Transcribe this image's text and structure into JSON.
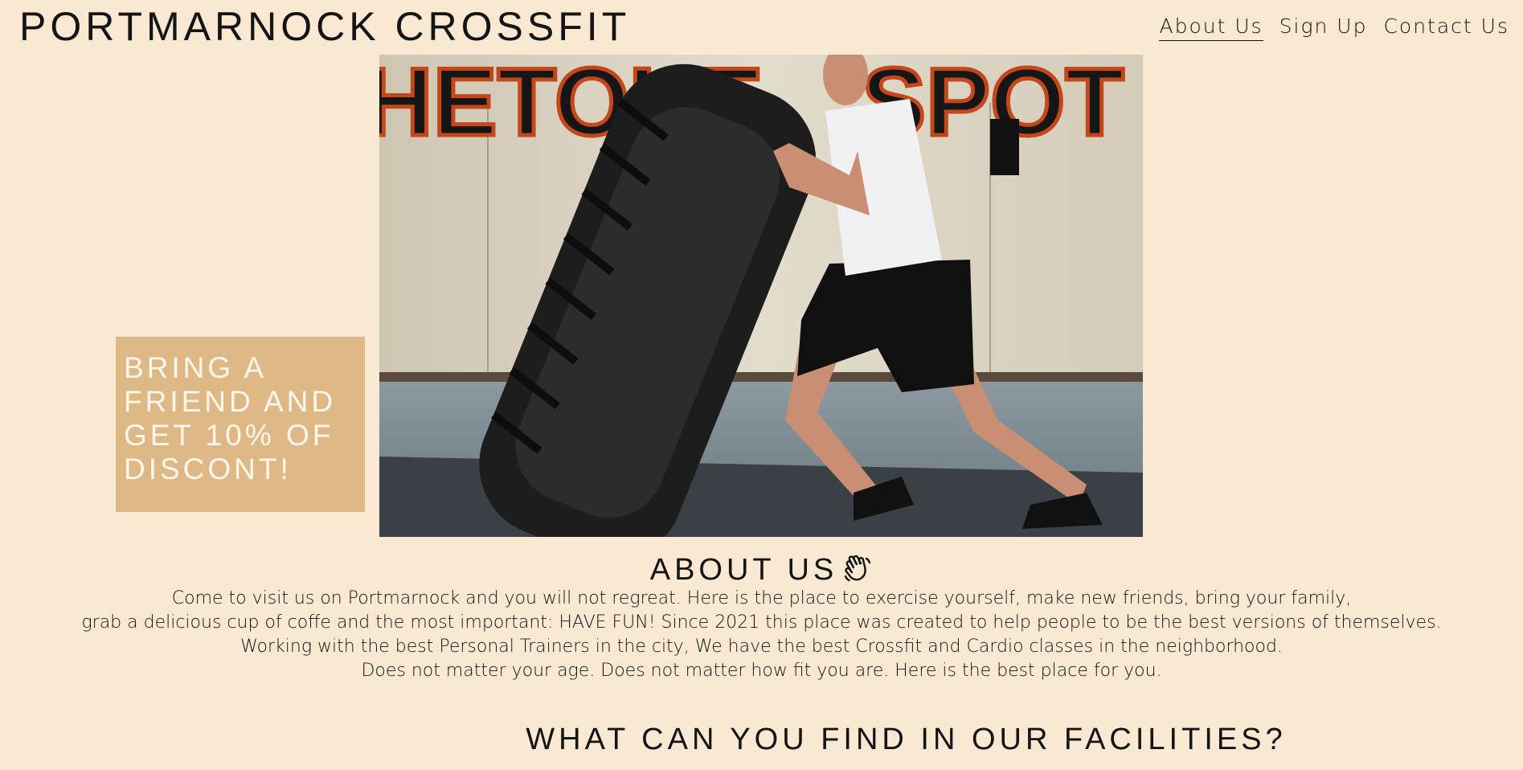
{
  "header": {
    "site_title": "PORTMARNOCK CROSSFIT",
    "nav": [
      {
        "label": "About Us",
        "active": true
      },
      {
        "label": "Sign Up",
        "active": false
      },
      {
        "label": "Contact Us",
        "active": false
      }
    ]
  },
  "hero": {
    "image": "crossfit-tire-flip-photo",
    "promo_text": "BRING A FRIEND AND GET 10% OF DISCONT!"
  },
  "about": {
    "heading": "ABOUT US",
    "heading_icon": "waving-hand-icon",
    "lines": [
      "Come to visit us on Portmarnock and you will not regreat. Here is the place to exercise yourself, make new friends, bring your family,",
      "grab a delicious cup of coffe and the most important: HAVE FUN! Since 2021 this place was created to help people to be the best versions of themselves.",
      "Working with the best Personal Trainers in the city, We have the best Crossfit and Cardio classes in the neighborhood.",
      "Does not matter your age. Does not matter how fit you are. Here is the best place for you."
    ]
  },
  "facilities": {
    "heading": "WHAT CAN YOU FIND IN OUR FACILITIES?"
  },
  "colors": {
    "background": "#f9e8d2",
    "promo_box": "#deb887",
    "text": "#141414"
  }
}
